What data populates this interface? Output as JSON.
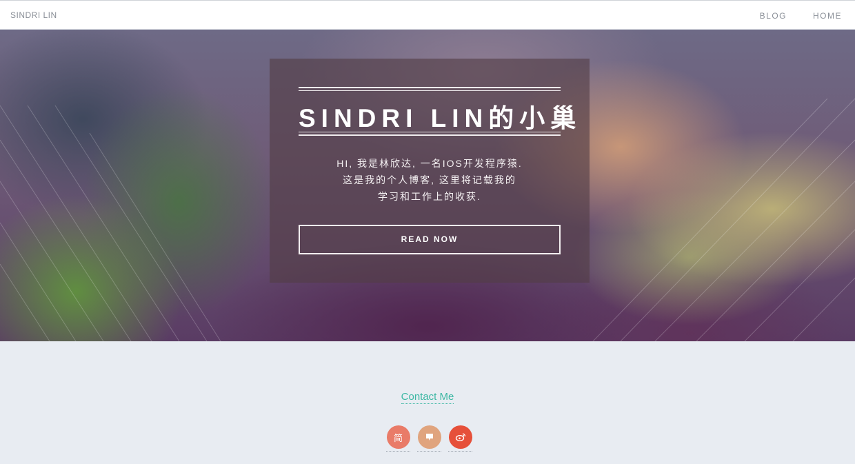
{
  "header": {
    "brand": "SINDRI LIN",
    "nav": [
      {
        "label": "BLOG"
      },
      {
        "label": "HOME"
      }
    ]
  },
  "hero": {
    "title": "SINDRI LIN的小巢",
    "subtitle_lines": [
      "HI, 我是林欣达, 一名IOS开发程序猿.",
      "这是我的个人博客, 这里将记载我的",
      "学习和工作上的收获."
    ],
    "button_label": "READ NOW"
  },
  "contact": {
    "link_label": "Contact Me",
    "social": [
      {
        "icon": "jianshu-icon",
        "glyph": "简",
        "color": "#ea6f5a"
      },
      {
        "icon": "chat-icon",
        "glyph": "▬",
        "color": "#e0a47e"
      },
      {
        "icon": "weibo-icon",
        "glyph": "微",
        "color": "#e6503a"
      }
    ]
  }
}
